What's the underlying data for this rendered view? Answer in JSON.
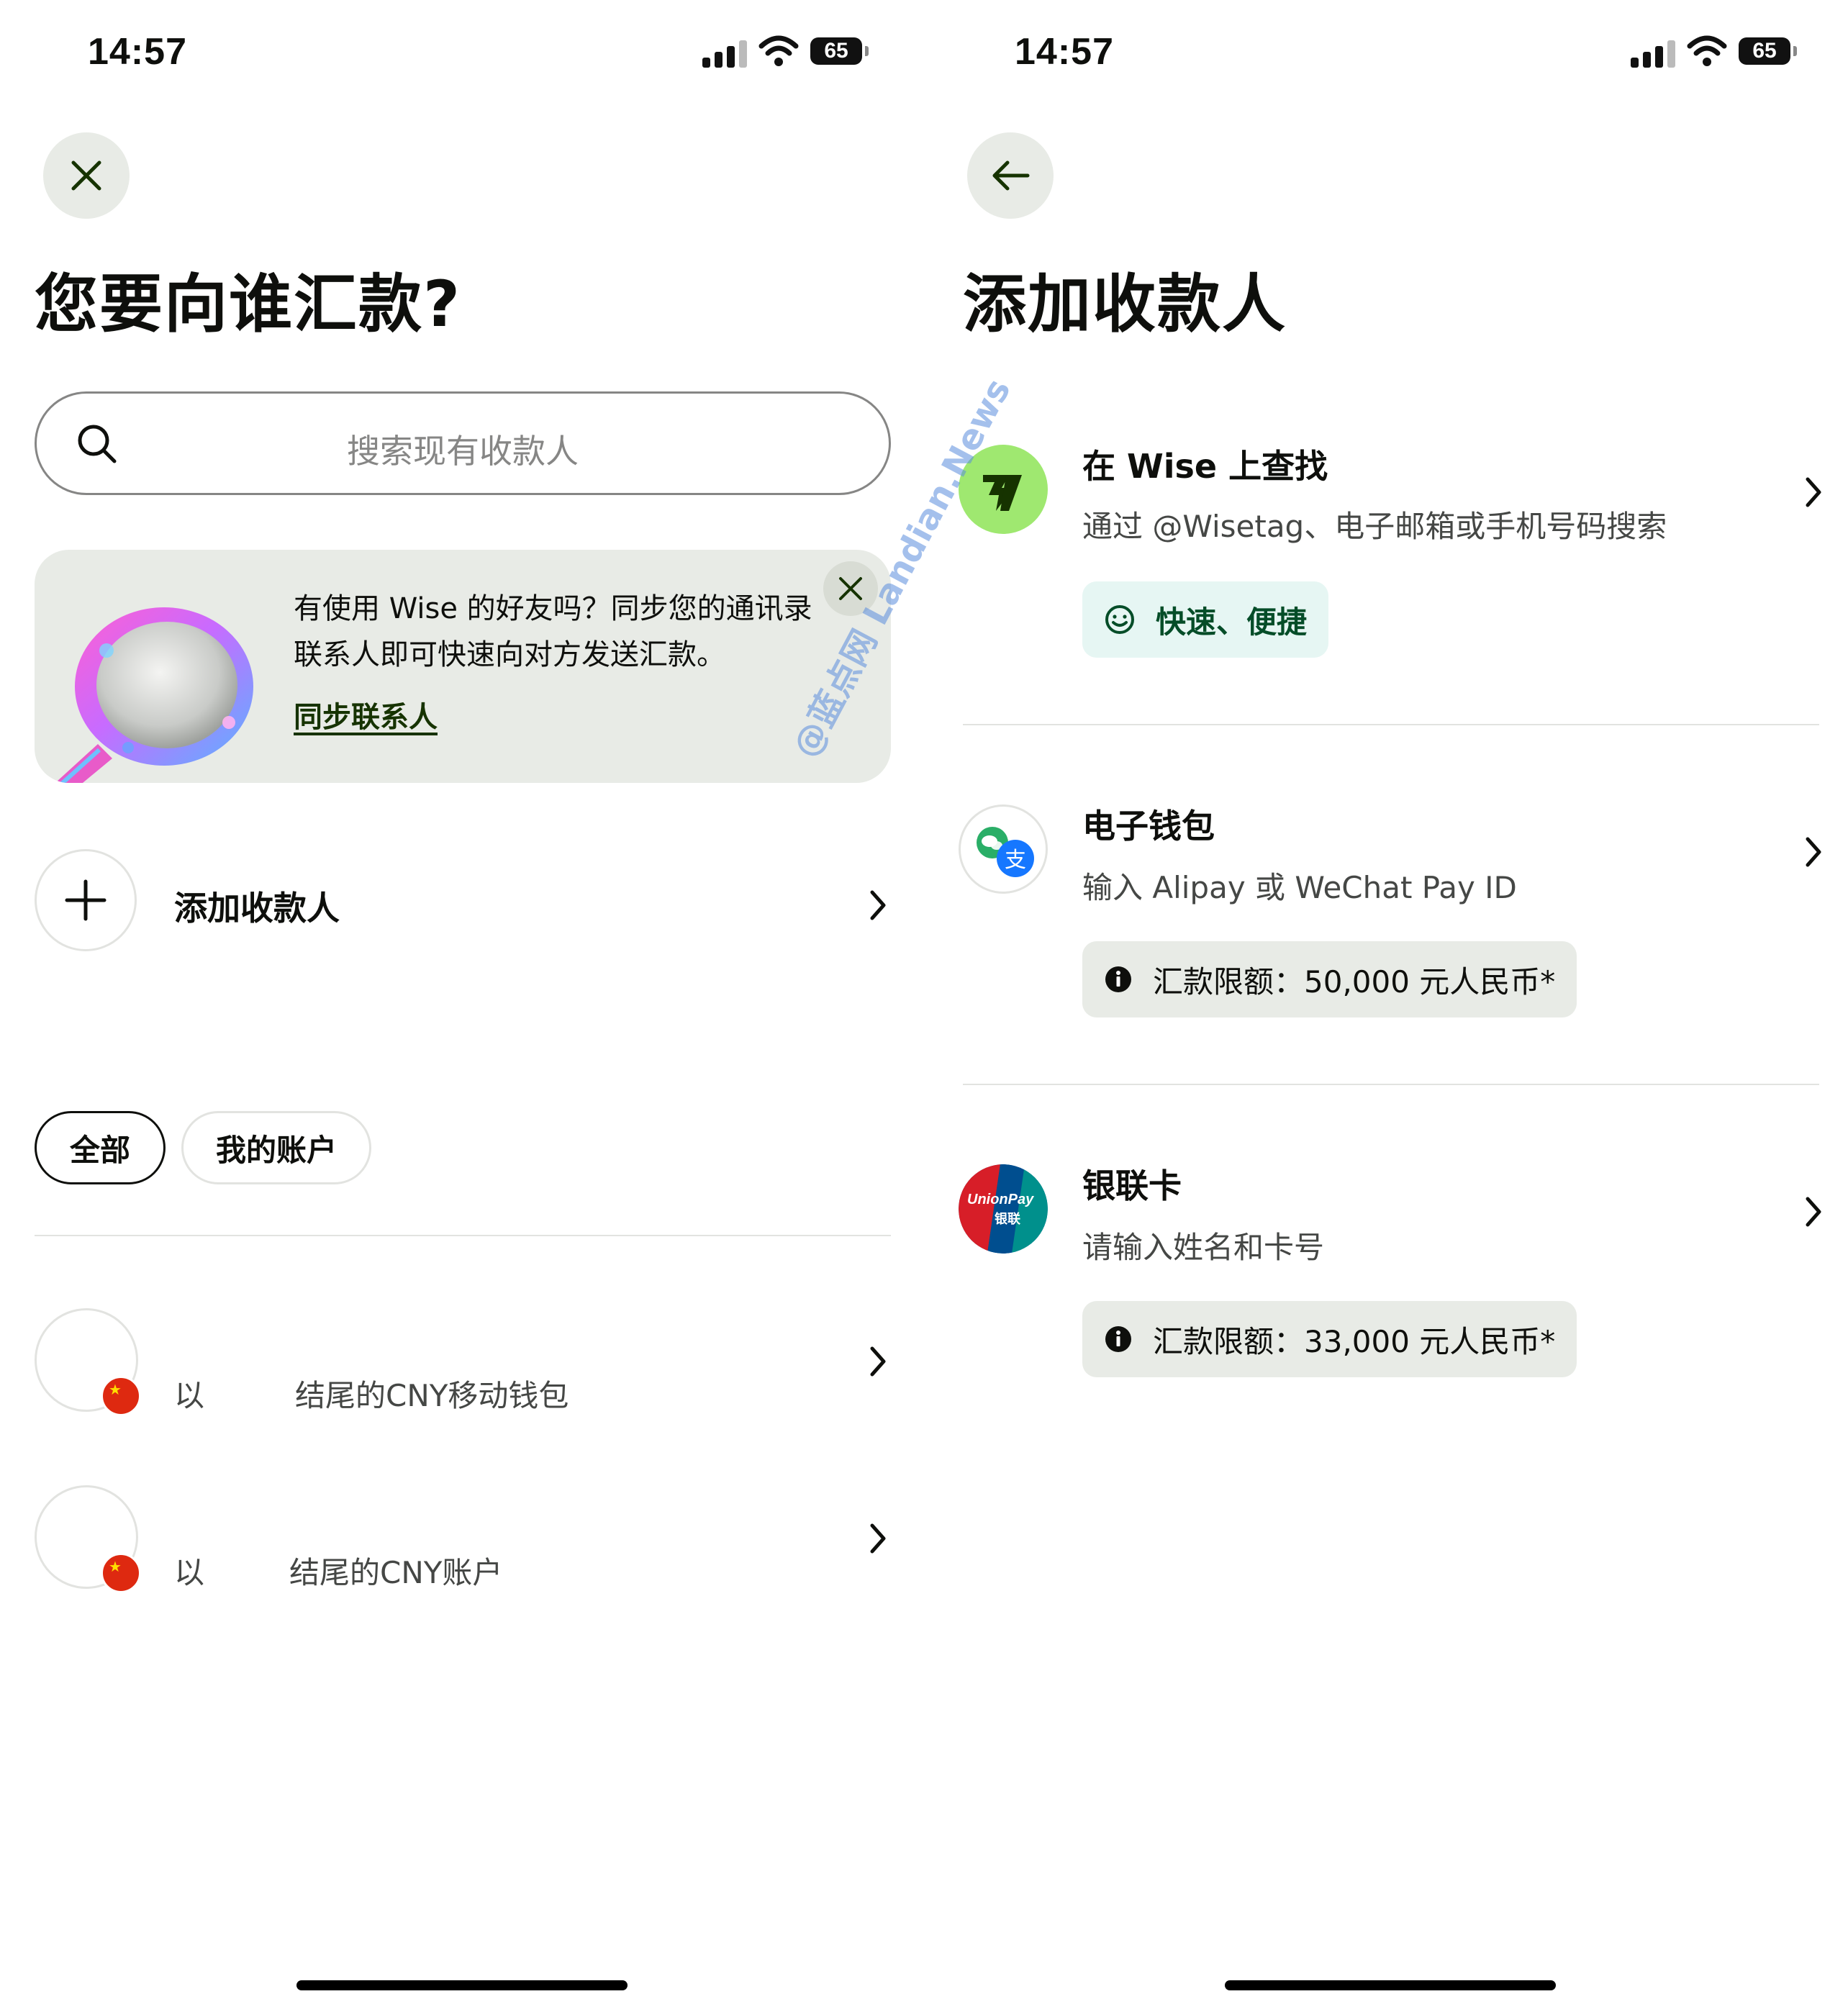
{
  "left": {
    "status": {
      "time": "14:57",
      "battery": "65"
    },
    "title": "您要向谁汇款?",
    "search": {
      "placeholder": "搜索现有收款人"
    },
    "promo": {
      "text": "有使用 Wise 的好友吗？同步您的通讯录联系人即可快速向对方发送汇款。",
      "link": "同步联系人"
    },
    "add_recipient": {
      "label": "添加收款人"
    },
    "filters": [
      {
        "label": "全部",
        "active": true
      },
      {
        "label": "我的账户",
        "active": false
      }
    ],
    "recipients": [
      {
        "prefix": "以",
        "suffix": "结尾的CNY移动钱包"
      },
      {
        "prefix": "以",
        "suffix": "结尾的CNY账户"
      }
    ]
  },
  "right": {
    "status": {
      "time": "14:57",
      "battery": "65"
    },
    "title": "添加收款人",
    "options": [
      {
        "title": "在 Wise 上查找",
        "desc": "通过 @Wisetag、电子邮箱或手机号码搜索",
        "tag": "快速、便捷",
        "icon": "wise-logo-icon"
      },
      {
        "title": "电子钱包",
        "desc": "输入 Alipay 或 WeChat Pay ID",
        "tag": "汇款限额：50,000 元人民币*",
        "icon": "wallet-icon"
      },
      {
        "title": "银联卡",
        "desc": "请输入姓名和卡号",
        "tag": "汇款限额：33,000 元人民币*",
        "icon": "unionpay-icon",
        "logo_text": "UnionPay",
        "logo_text_cn": "银联"
      }
    ]
  },
  "watermark": "@蓝点网 Landian.News",
  "colors": {
    "brand_green": "#9fe870",
    "forest": "#163300",
    "tag_green_bg": "#e6f6f3",
    "neutral_bg": "#e8ebe6"
  }
}
